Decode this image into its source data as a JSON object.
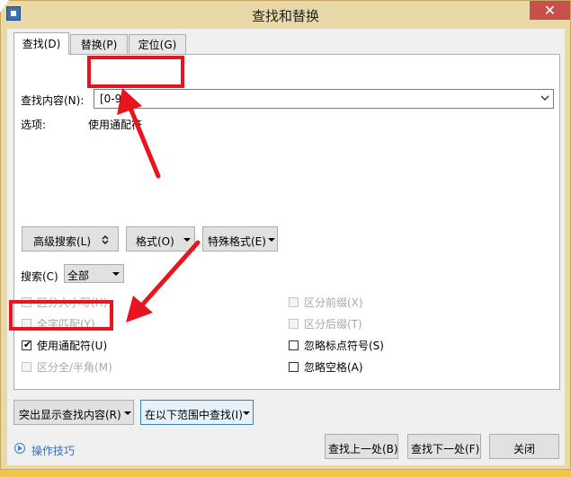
{
  "window": {
    "title": "查找和替换"
  },
  "tabs": [
    {
      "label": "查找(D)"
    },
    {
      "label": "替换(P)"
    },
    {
      "label": "定位(G)"
    }
  ],
  "find": {
    "label": "查找内容(N):",
    "value": "[0-9]",
    "options_label": "选项:",
    "options_value": "使用通配符"
  },
  "buttons": {
    "advanced": "高级搜索(L)",
    "format": "格式(O)",
    "special": "特殊格式(E)",
    "highlight": "突出显示查找内容(R)",
    "find_in": "在以下范围中查找(I)",
    "find_prev": "查找上一处(B)",
    "find_next": "查找下一处(F)",
    "close": "关闭"
  },
  "search": {
    "label": "搜索(C)",
    "value": "全部"
  },
  "options_left": [
    {
      "label": "区分大小写(H)",
      "checked": false,
      "disabled": true
    },
    {
      "label": "全字匹配(Y)",
      "checked": false,
      "disabled": true
    },
    {
      "label": "使用通配符(U)",
      "checked": true,
      "disabled": false
    },
    {
      "label": "区分全/半角(M)",
      "checked": false,
      "disabled": true
    }
  ],
  "options_right": [
    {
      "label": "区分前缀(X)",
      "checked": false,
      "disabled": true
    },
    {
      "label": "区分后缀(T)",
      "checked": false,
      "disabled": true
    },
    {
      "label": "忽略标点符号(S)",
      "checked": false,
      "disabled": false
    },
    {
      "label": "忽略空格(A)",
      "checked": false,
      "disabled": false
    }
  ],
  "tips": {
    "label": "操作技巧"
  },
  "colors": {
    "annotation": "#e8141f",
    "link": "#2f6fc5"
  }
}
